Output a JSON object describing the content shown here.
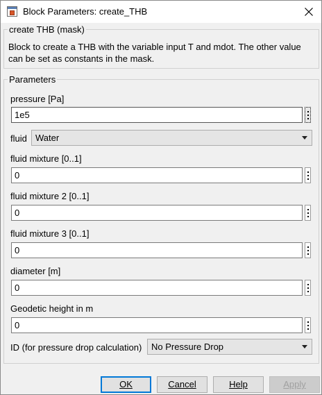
{
  "window": {
    "title": "Block Parameters: create_THB",
    "close_symbol": "✕",
    "app_icon": "simulink-block-icon"
  },
  "mask": {
    "legend": "create THB (mask)",
    "description": "Block to create a THB with the variable input T and mdot. The other value can be set as constants in the mask."
  },
  "parameters": {
    "legend": "Parameters",
    "pressure": {
      "label": "pressure [Pa]",
      "value": "1e5"
    },
    "fluid": {
      "label": "fluid",
      "selected": "Water"
    },
    "fluid_mixture": {
      "label": "fluid mixture [0..1]",
      "value": "0"
    },
    "fluid_mixture_2": {
      "label": "fluid mixture 2 [0..1]",
      "value": "0"
    },
    "fluid_mixture_3": {
      "label": "fluid mixture 3 [0..1]",
      "value": "0"
    },
    "diameter": {
      "label": "diameter [m]",
      "value": "0"
    },
    "geodetic_height": {
      "label": "Geodetic height in m",
      "value": "0"
    },
    "pressure_drop_id": {
      "label": "ID (for pressure drop calculation)",
      "selected": "No Pressure Drop"
    }
  },
  "buttons": {
    "ok": "OK",
    "cancel": "Cancel",
    "help": "Help",
    "apply": "Apply"
  },
  "colors": {
    "focus_border": "#0078d7",
    "window_bg": "#f0f0f0",
    "disabled_text": "#a0a0a0"
  }
}
